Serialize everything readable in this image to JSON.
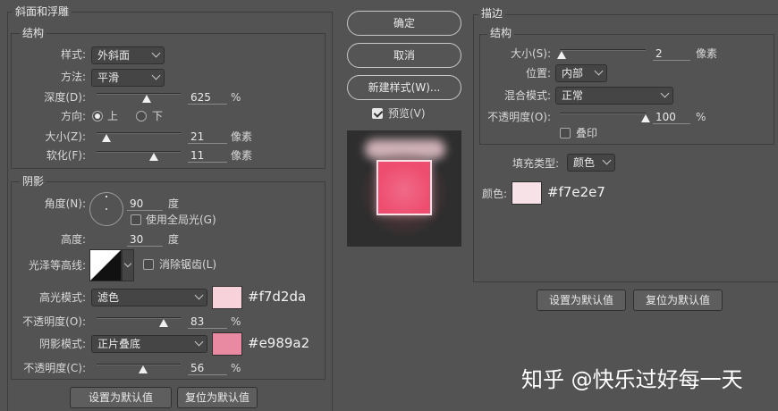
{
  "bevel": {
    "title": "斜面和浮雕",
    "structure": {
      "title": "结构",
      "style_label": "样式:",
      "style_value": "外斜面",
      "technique_label": "方法:",
      "technique_value": "平滑",
      "depth_label": "深度(D):",
      "depth_value": "625",
      "depth_unit": "%",
      "depth_fraction": 0.6,
      "direction_label": "方向:",
      "dir_up": "上",
      "dir_down": "下",
      "size_label": "大小(Z):",
      "size_value": "21",
      "size_unit": "像素",
      "size_fraction": 0.12,
      "soften_label": "软化(F):",
      "soften_value": "11",
      "soften_unit": "像素",
      "soften_fraction": 0.68
    },
    "shading": {
      "title": "阴影",
      "angle_label": "角度(N):",
      "angle_value": "90",
      "angle_unit": "度",
      "global_light_label": "使用全局光(G)",
      "altitude_label": "高度:",
      "altitude_value": "30",
      "altitude_unit": "度",
      "gloss_label": "光泽等高线:",
      "antialias_label": "消除锯齿(L)",
      "highlight_label": "高光模式:",
      "highlight_value": "滤色",
      "highlight_color": "#f7d2da",
      "highlight_hex": "#f7d2da",
      "hl_opacity_label": "不透明度(O):",
      "hl_opacity_value": "83",
      "hl_opacity_unit": "%",
      "hl_opacity_fraction": 0.8,
      "shadow_label": "阴影模式:",
      "shadow_value": "正片叠底",
      "shadow_color": "#e989a2",
      "shadow_hex": "#e989a2",
      "sh_opacity_label": "不透明度(C):",
      "sh_opacity_value": "56",
      "sh_opacity_unit": "%",
      "sh_opacity_fraction": 0.55
    },
    "make_default": "设置为默认值",
    "reset_default": "复位为默认值"
  },
  "center": {
    "ok": "确定",
    "cancel": "取消",
    "new_style": "新建样式(W)...",
    "preview_label": "预览(V)"
  },
  "stroke": {
    "title": "描边",
    "structure": {
      "title": "结构",
      "size_label": "大小(S):",
      "size_value": "2",
      "size_unit": "像素",
      "size_fraction": 0.02,
      "position_label": "位置:",
      "position_value": "内部",
      "blend_label": "混合模式:",
      "blend_value": "正常",
      "opacity_label": "不透明度(O):",
      "opacity_value": "100",
      "opacity_unit": "%",
      "opacity_fraction": 1.0,
      "overprint_label": "叠印"
    },
    "fill_type_label": "填充类型:",
    "fill_type_value": "颜色",
    "color_label": "颜色:",
    "color": "#f7e2e7",
    "color_hex": "#f7e2e7",
    "make_default": "设置为默认值",
    "reset_default": "复位为默认值"
  },
  "watermark": "知乎 @快乐过好每一天",
  "preview_colors": {
    "square": "#ee4d6f",
    "glow": "#f7d2da"
  }
}
